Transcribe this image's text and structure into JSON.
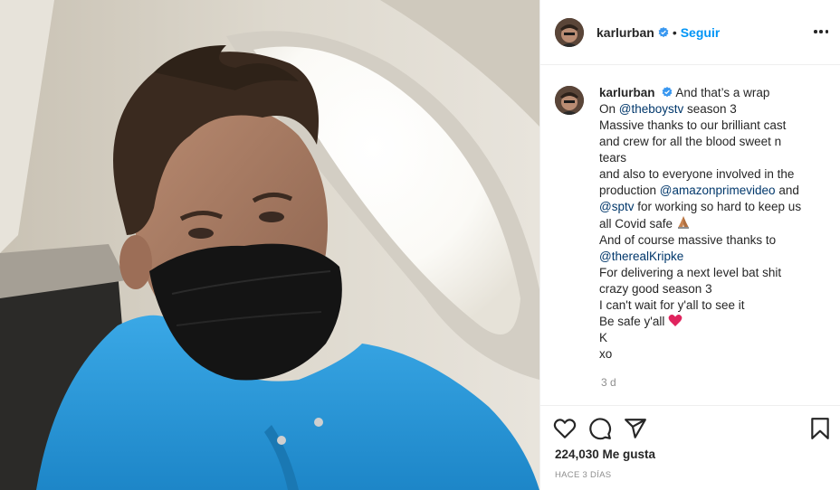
{
  "header": {
    "username": "karlurban",
    "separator": "•",
    "follow_label": "Seguir",
    "more_icon": "more-options-icon"
  },
  "caption": {
    "username": "karlurban",
    "line1": "And that’s a wrap",
    "line2_prefix": "On ",
    "mention_boys": "@theboystv",
    "line2_suffix": " season 3",
    "line3": "Massive thanks to our brilliant cast",
    "line4": "and crew for all the blood sweet n",
    "line5": "tears",
    "line6": "and also to everyone involved in the",
    "line7_prefix": "production ",
    "mention_amazon": "@amazonprimevideo",
    "line7_suffix": " and",
    "mention_sptv": "@sptv",
    "line8_suffix": " for working so hard to keep us",
    "line9": "all Covid safe",
    "line10": "And of course massive thanks to",
    "mention_kripke": "@therealKripke",
    "line12": "For delivering a next level bat shit",
    "line13": "crazy good season 3",
    "line14": "I can't wait for y'all to see it",
    "line15": "Be safe y'all",
    "line16": "K",
    "line17": "xo",
    "age": "3 d"
  },
  "actions": {
    "like_icon": "heart-icon",
    "comment_icon": "comment-icon",
    "share_icon": "share-icon",
    "save_icon": "bookmark-icon"
  },
  "likes_text": "224,030 Me gusta",
  "date_text": "HACE 3 DÍAS",
  "colors": {
    "link": "#0095f6",
    "mention": "#00376b",
    "muted": "#8e8e8e",
    "verified": "#3897f0",
    "heart_emoji": "#e0245e",
    "hoodie": "#2d9bd8"
  }
}
